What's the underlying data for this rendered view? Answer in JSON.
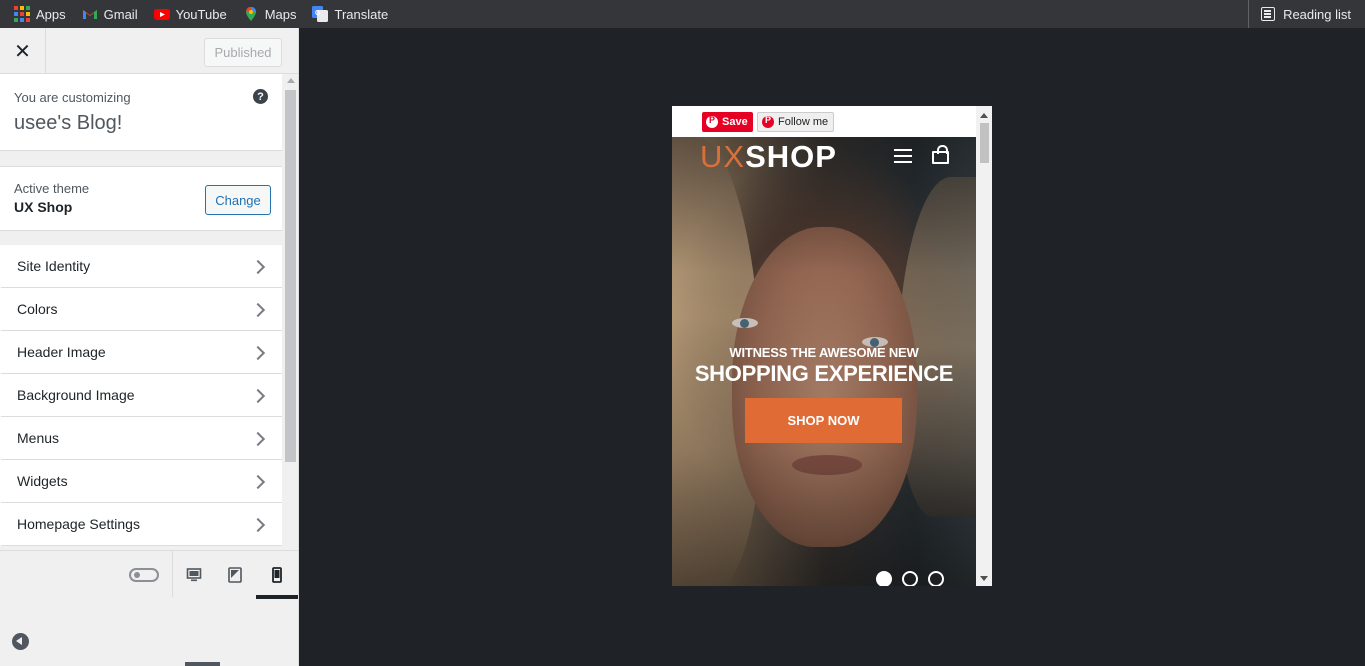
{
  "bookmarks": [
    {
      "label": "Apps",
      "icon": "apps-grid-icon"
    },
    {
      "label": "Gmail",
      "icon": "gmail-icon"
    },
    {
      "label": "YouTube",
      "icon": "youtube-icon"
    },
    {
      "label": "Maps",
      "icon": "maps-pin-icon"
    },
    {
      "label": "Translate",
      "icon": "translate-icon"
    }
  ],
  "reading_list": {
    "label": "Reading list",
    "icon": "reading-list-icon"
  },
  "customizer": {
    "publish_label": "Published",
    "info_small": "You are customizing",
    "site_name": "usee's Blog!",
    "help_glyph": "?",
    "active_theme_label": "Active theme",
    "theme_name": "UX Shop",
    "change_label": "Change",
    "sections": [
      {
        "label": "Site Identity"
      },
      {
        "label": "Colors"
      },
      {
        "label": "Header Image"
      },
      {
        "label": "Background Image"
      },
      {
        "label": "Menus"
      },
      {
        "label": "Widgets"
      },
      {
        "label": "Homepage Settings"
      }
    ],
    "selected_device": "mobile"
  },
  "preview": {
    "pinterest": {
      "save_label": "Save",
      "follow_label": "Follow me"
    },
    "logo": {
      "part1": "UX",
      "part2": "SHOP"
    },
    "tagline": "WITNESS THE AWESOME NEW",
    "headline": "SHOPPING EXPERIENCE",
    "cta_label": "SHOP NOW",
    "slides": 3,
    "active_slide": 1
  },
  "colors": {
    "accent": "#e06b35",
    "wp_blue": "#2271b1",
    "pinterest_red": "#e60023",
    "browser_bar": "#35363a",
    "preview_bg": "#1f2327"
  }
}
